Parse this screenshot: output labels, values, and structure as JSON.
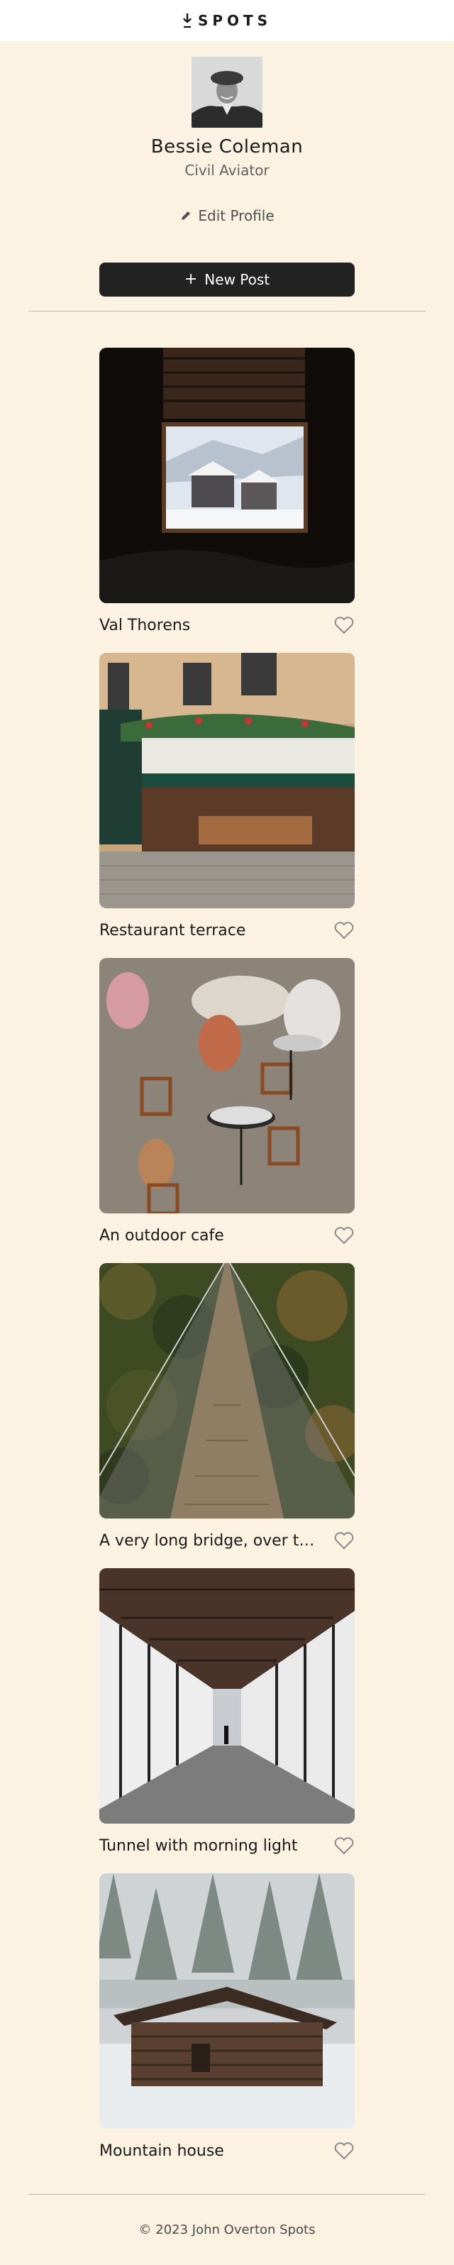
{
  "header": {
    "logo_text": "SPOTS",
    "logo_icon": "map-pin-icon"
  },
  "profile": {
    "name": "Bessie Coleman",
    "role": "Civil Aviator",
    "edit_label": "Edit Profile",
    "edit_icon": "pencil-icon"
  },
  "actions": {
    "new_post_label": "New Post",
    "new_post_icon": "plus-icon"
  },
  "cards": [
    {
      "title": "Val Thorens",
      "liked": false
    },
    {
      "title": "Restaurant terrace",
      "liked": false
    },
    {
      "title": "An outdoor cafe",
      "liked": false
    },
    {
      "title": "A very long bridge, over the forest and through the trees",
      "liked": false
    },
    {
      "title": "Tunnel with morning light",
      "liked": false
    },
    {
      "title": "Mountain house",
      "liked": false
    }
  ],
  "footer": {
    "copyright": "© 2023 John Overton Spots"
  },
  "colors": {
    "background": "#fbf2e2",
    "button": "#222222",
    "heart": "#8a8a8a"
  }
}
